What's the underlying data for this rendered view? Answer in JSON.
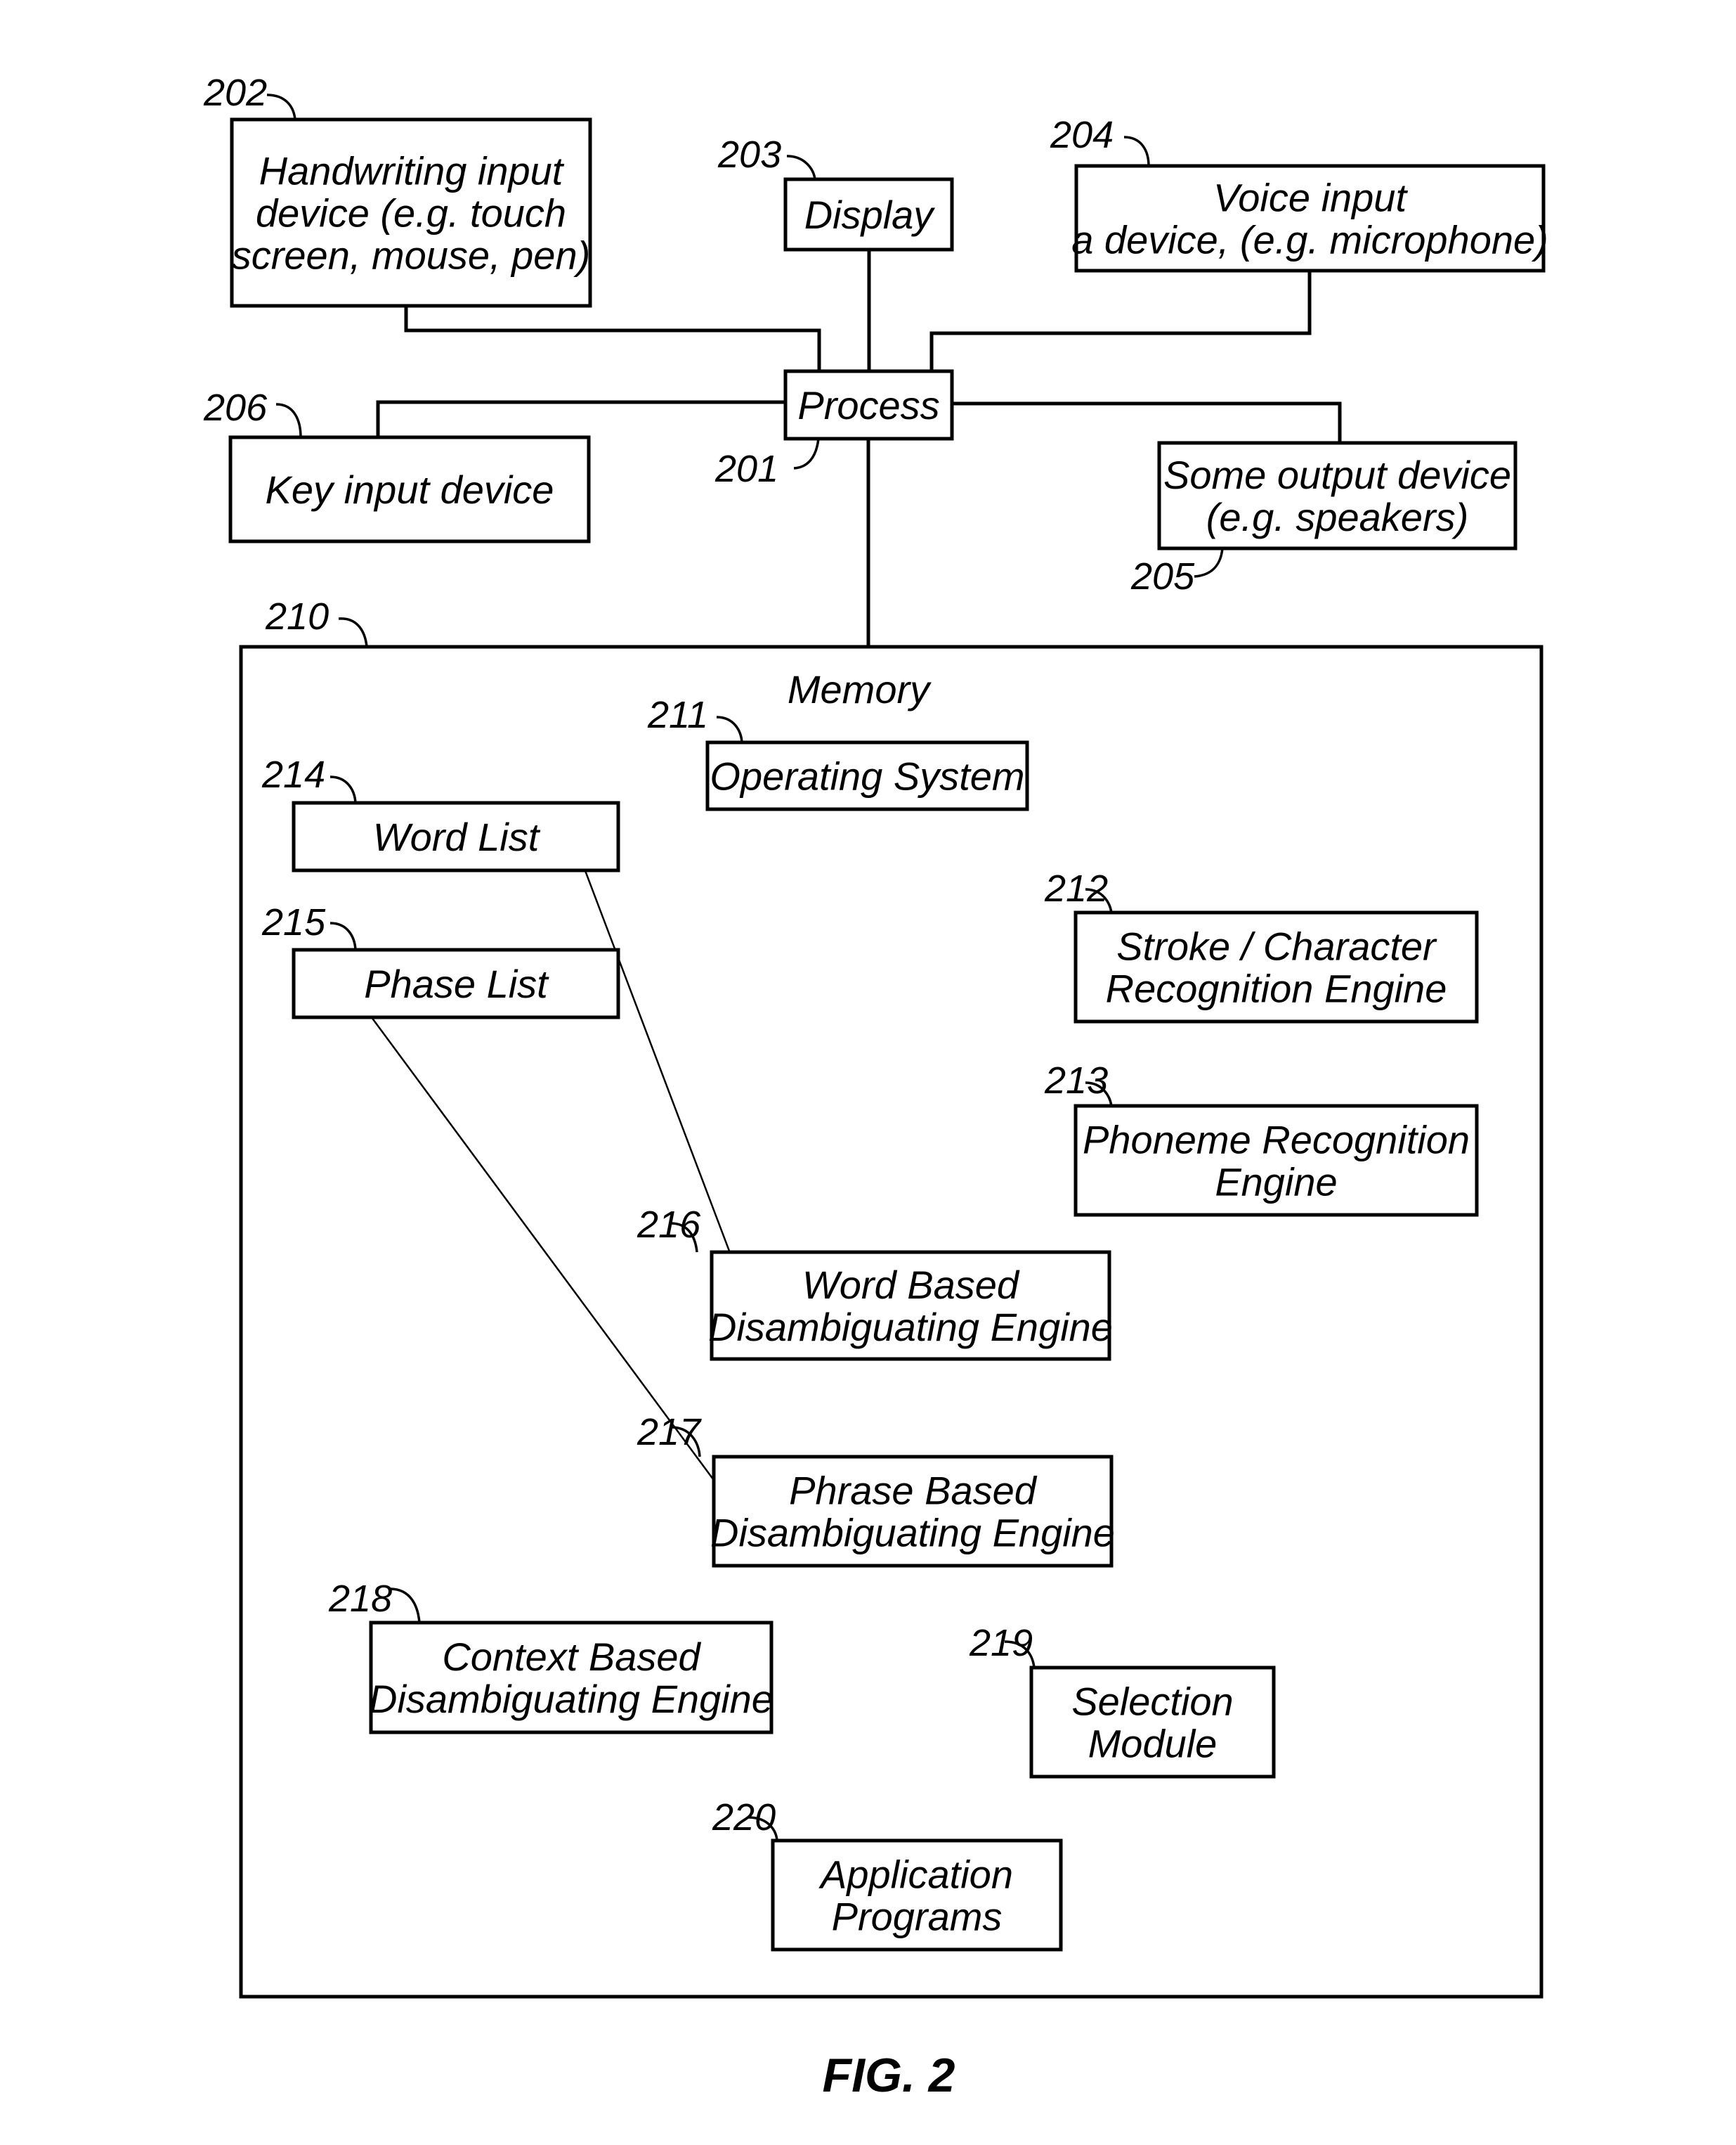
{
  "figure": {
    "caption": "FIG. 2",
    "memory_label": "Memory",
    "memory_ref": "210"
  },
  "components": {
    "handwriting": {
      "ref": "202",
      "lines": [
        "Handwriting input",
        "device (e.g. touch",
        "screen, mouse, pen)"
      ]
    },
    "display": {
      "ref": "203",
      "lines": [
        "Display"
      ]
    },
    "voice": {
      "ref": "204",
      "lines": [
        "Voice input",
        "a device, (e.g. microphone)"
      ]
    },
    "process": {
      "ref": "201",
      "lines": [
        "Process"
      ]
    },
    "key_input": {
      "ref": "206",
      "lines": [
        "Key input device"
      ]
    },
    "output": {
      "ref": "205",
      "lines": [
        "Some output device",
        "(e.g. speakers)"
      ]
    },
    "os": {
      "ref": "211",
      "lines": [
        "Operating System"
      ]
    },
    "word_list": {
      "ref": "214",
      "lines": [
        "Word List"
      ]
    },
    "phase_list": {
      "ref": "215",
      "lines": [
        "Phase List"
      ]
    },
    "stroke": {
      "ref": "212",
      "lines": [
        "Stroke / Character",
        "Recognition Engine"
      ]
    },
    "phoneme": {
      "ref": "213",
      "lines": [
        "Phoneme Recognition",
        "Engine"
      ]
    },
    "word_engine": {
      "ref": "216",
      "lines": [
        "Word Based",
        "Disambiguating Engine"
      ]
    },
    "phrase_engine": {
      "ref": "217",
      "lines": [
        "Phrase Based",
        "Disambiguating Engine"
      ]
    },
    "context_engine": {
      "ref": "218",
      "lines": [
        "Context Based",
        "Disambiguating Engine"
      ]
    },
    "selection": {
      "ref": "219",
      "lines": [
        "Selection",
        "Module"
      ]
    },
    "apps": {
      "ref": "220",
      "lines": [
        "Application",
        "Programs"
      ]
    }
  }
}
